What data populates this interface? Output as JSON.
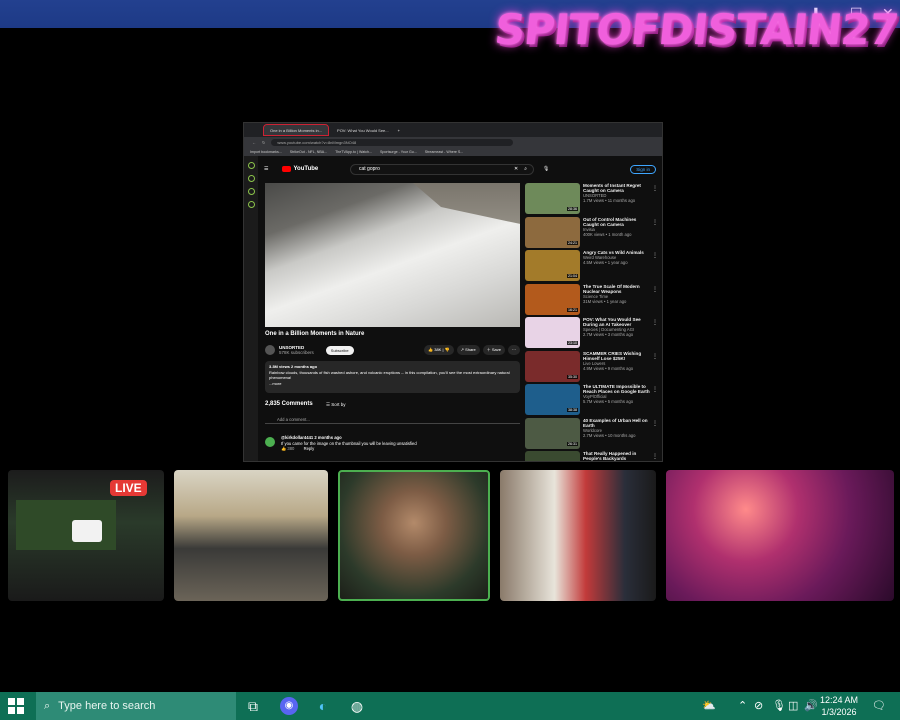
{
  "stream_overlay": {
    "channel_logo": "SPITOFDISTAIN27"
  },
  "browser": {
    "tabs": [
      "One in a Billion Moments in...",
      "POV: What You Would See..."
    ],
    "url": "www.youtube.com/watch?v=8nMmgn3NO48",
    "bookmarks": [
      "Import bookmarks...",
      "StrikeOut - NFL, NBA...",
      "TheTVApp.to | Watch...",
      "Sportsurge - Your Gu...",
      "Streameast - Where S..."
    ],
    "search_query": "cat gopro",
    "sign_in": "Sign in",
    "yt_logo": "YouTube"
  },
  "video": {
    "title": "One in a Billion Moments in Nature",
    "channel": "UNSORTED",
    "subscribers": "578K subscribers",
    "subscribe_label": "Subscribe",
    "likes": "38K",
    "share_label": "Share",
    "save_label": "Save",
    "views_age": "3.3M views  2 months ago",
    "description": "Rainbow clouds, thousands of fish washed ashore, and volcanic eruptions -- in this compilation, you'll see the most extraordinary natural phenomena!",
    "more_label": "...more",
    "comments_count": "2,835 Comments",
    "sort_label": "Sort by",
    "add_comment": "Add a comment...",
    "first_comment_user": "@kirkdollar4441  2 months ago",
    "first_comment_text": "If you came for the image on the thumbnail you will be leaving unsatisfied",
    "first_comment_likes": "380",
    "reply_label": "Reply"
  },
  "recommendations": [
    {
      "title": "Moments of Instant Regret Caught on Camera",
      "channel": "UNSORTED",
      "meta": "1.7M views • 11 months ago",
      "duration": "28:36",
      "color": "#6e8a5a"
    },
    {
      "title": "Out of Control Machines Caught on Camera",
      "channel": "Invisia",
      "meta": "400K views • 1 month ago",
      "duration": "24:21",
      "color": "#8d6a3e"
    },
    {
      "title": "Angry Cats vs Wild Animals",
      "channel": "Weird Warehouse",
      "meta": "4.5M views • 1 year ago",
      "duration": "21:04",
      "color": "#a37b2a"
    },
    {
      "title": "The True Scale Of Modern Nuclear Weapons",
      "channel": "Science Time",
      "meta": "31M views • 1 year ago",
      "duration": "16:21",
      "color": "#b35a1c"
    },
    {
      "title": "POV: What You Would See During an AI Takeover",
      "channel": "Species | Documenting AGI",
      "meta": "2.7M views • 3 months ago",
      "duration": "23:10",
      "color": "#e8d3e6"
    },
    {
      "title": "SCAMMER CRIES Wishing Himself Lose $25K!",
      "channel": "Live Lowers",
      "meta": "4.9M views • 9 months ago",
      "duration": "35:30",
      "color": "#7a2b2b"
    },
    {
      "title": "The ULTIMATE Impossible to Reach Places on Google Earth",
      "channel": "VoyPlOfficial",
      "meta": "5.7M views • 5 months ago",
      "duration": "38:38",
      "color": "#1e5e8c"
    },
    {
      "title": "40 Examples of Urban Hell on Earth",
      "channel": "Worldcore",
      "meta": "2.7M views • 10 months ago",
      "duration": "26:31",
      "color": "#4d5a44"
    },
    {
      "title": "That Really Happened in People's Backyards",
      "channel": "",
      "meta": "",
      "duration": "",
      "color": "#3a4a30"
    }
  ],
  "overlay": {
    "live_label": "LIVE"
  },
  "taskbar": {
    "search_placeholder": "Type here to search",
    "time": "12:24 AM",
    "date": "1/3/2026"
  }
}
